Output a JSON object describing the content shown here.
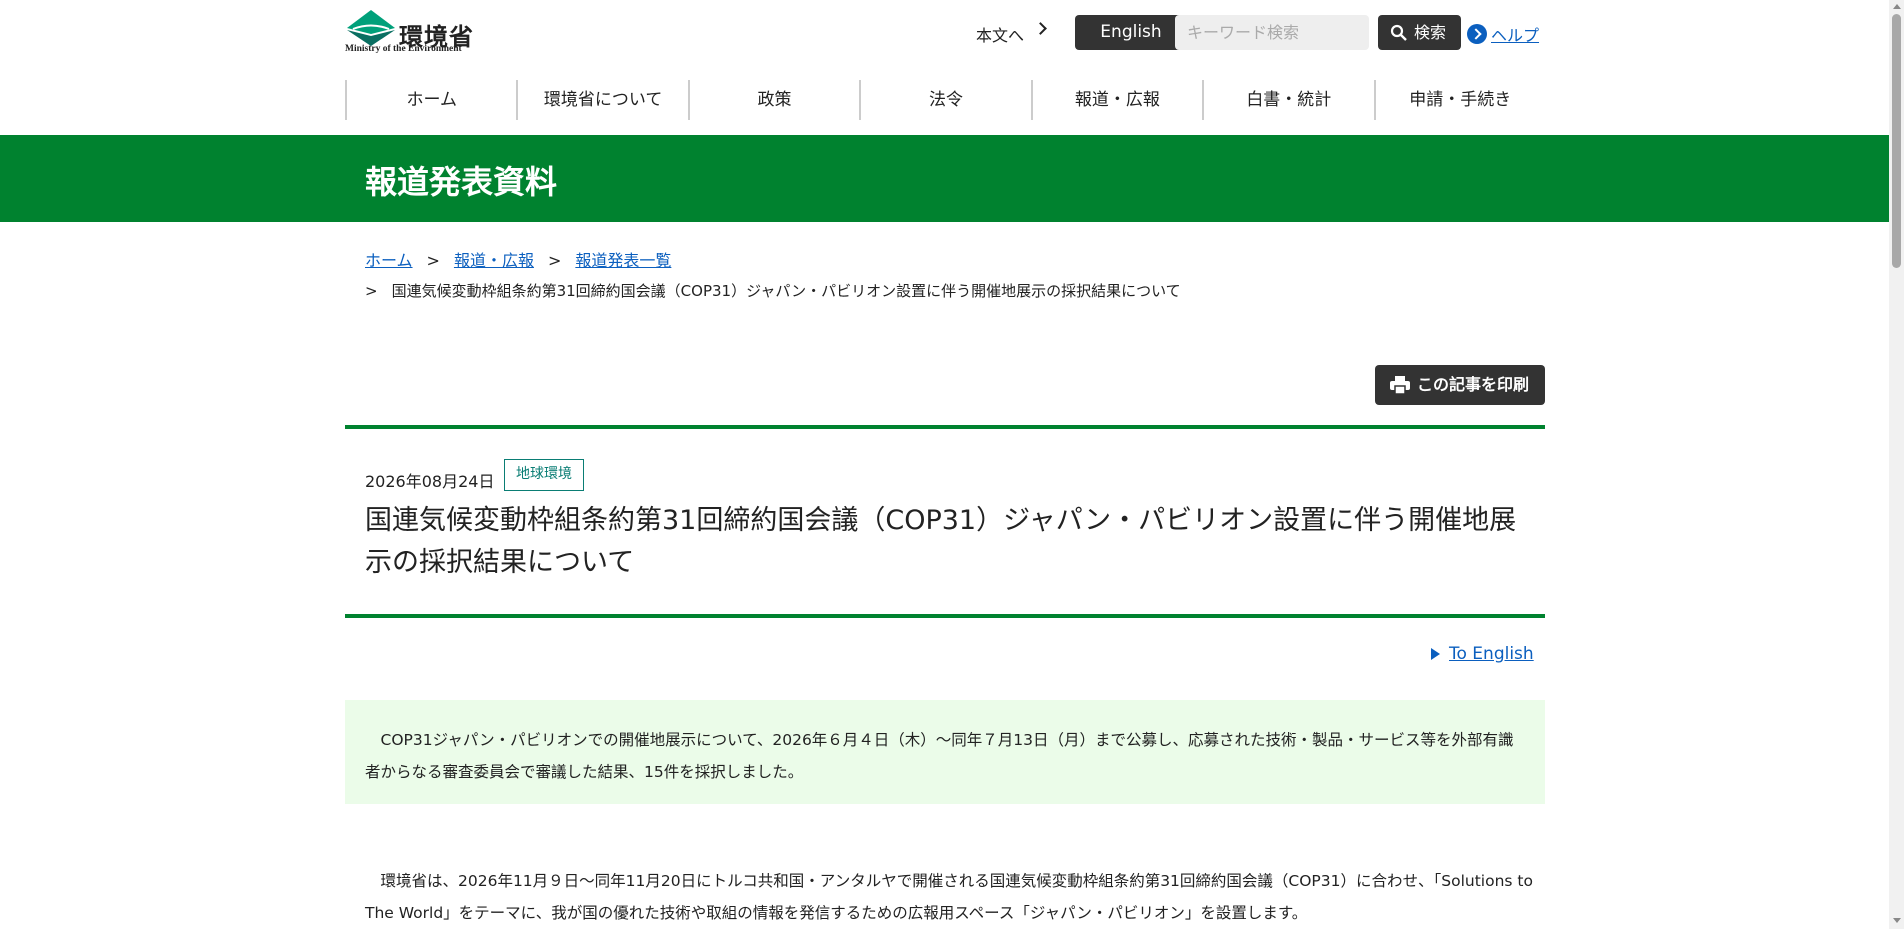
{
  "header": {
    "logo_jp": "環境省",
    "logo_en": "Ministry of the Environment",
    "skip_link": "本文へ",
    "english_button": "English",
    "search_placeholder": "キーワード検索",
    "search_button": "検索",
    "help_link": "ヘルプ"
  },
  "nav": [
    "ホーム",
    "環境省について",
    "政策",
    "法令",
    "報道・広報",
    "白書・統計",
    "申請・手続き"
  ],
  "banner_title": "報道発表資料",
  "breadcrumb": {
    "items": [
      "ホーム",
      "報道・広報",
      "報道発表一覧"
    ],
    "separator": ">",
    "current": "国連気候変動枠組条約第31回締約国会議（COP31）ジャパン・パビリオン設置に伴う開催地展示の採択結果について"
  },
  "print_button": "この記事を印刷",
  "article": {
    "date": "2026年08月24日",
    "tag": "地球環境",
    "title": "国連気候変動枠組条約第31回締約国会議（COP31）ジャパン・パビリオン設置に伴う開催地展示の採択結果について",
    "to_english": "To English",
    "summary": "　COP31ジャパン・パビリオンでの開催地展示について、2026年６月４日（木）～同年７月13日（月）まで公募し、応募された技術・製品・サービス等を外部有識者からなる審査委員会で審議した結果、15件を採択しました。",
    "body": "　環境省は、2026年11月９日～同年11月20日にトルコ共和国・アンタルヤで開催される国連気候変動枠組条約第31回締約国会議（COP31）に合わせ、「Solutions to The World」をテーマに、我が国の優れた技術や取組の情報を発信するための広報用スペース「ジャパン・パビリオン」を設置します。"
  },
  "colors": {
    "brand_green": "#00822f",
    "link_blue": "#0b5fbf",
    "summary_bg": "#ebfce9",
    "tag_teal": "#0a7d74"
  }
}
